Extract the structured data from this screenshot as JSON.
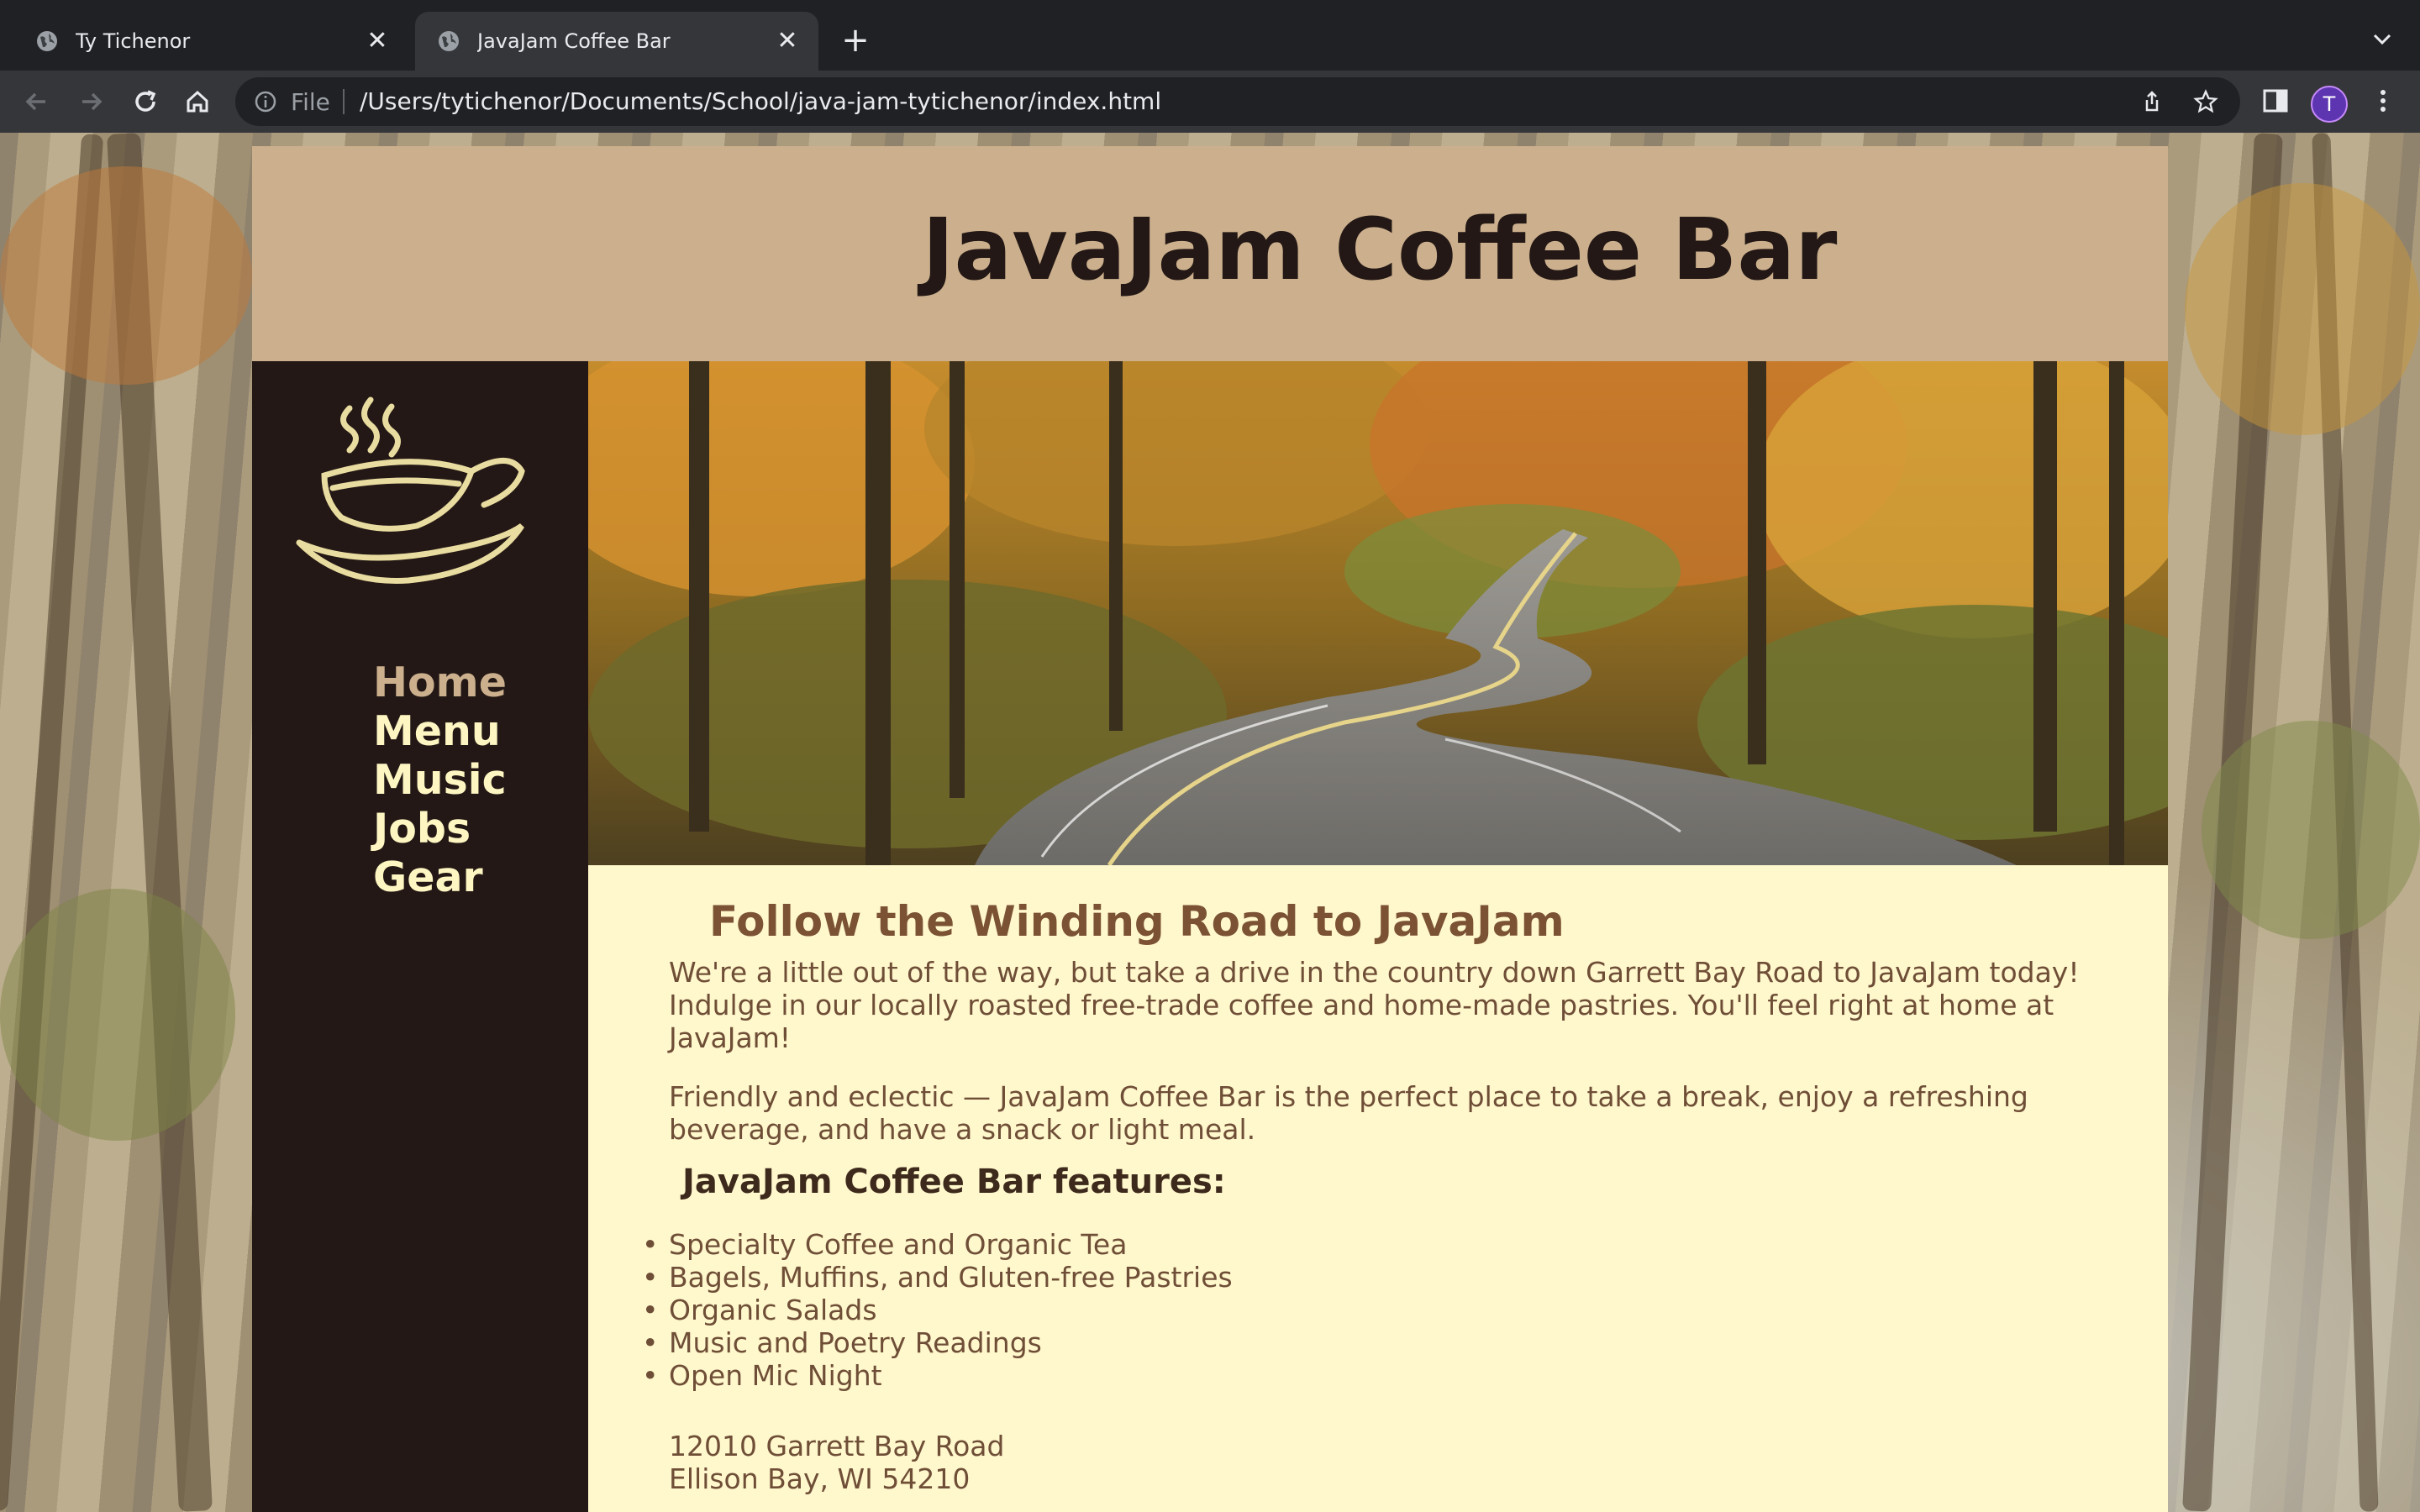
{
  "browser": {
    "tabs": [
      {
        "title": "Ty Tichenor",
        "active": false
      },
      {
        "title": "JavaJam Coffee Bar",
        "active": true
      }
    ],
    "address_bar": {
      "scheme_label": "File",
      "url": "/Users/tytichenor/Documents/School/java-jam-tytichenor/index.html"
    },
    "profile_initial": "T",
    "accent_color": "#5e35b1"
  },
  "page": {
    "site_title": "JavaJam Coffee Bar",
    "nav": [
      {
        "label": "Home",
        "current": true
      },
      {
        "label": "Menu",
        "current": false
      },
      {
        "label": "Music",
        "current": false
      },
      {
        "label": "Jobs",
        "current": false
      },
      {
        "label": "Gear",
        "current": false
      }
    ],
    "heading": "Follow the Winding Road to JavaJam",
    "intro_paragraph": "We're a little out of the way, but take a drive in the country down Garrett Bay Road to JavaJam today! Indulge in our locally roasted free-trade coffee and home-made pastries. You'll feel right at home at JavaJam!",
    "second_paragraph": "Friendly and eclectic — JavaJam Coffee Bar is the perfect place to take a break, enjoy a refreshing beverage, and have a snack or light meal.",
    "features_heading": "JavaJam Coffee Bar features:",
    "features": [
      "Specialty Coffee and Organic Tea",
      "Bagels, Muffins, and Gluten-free Pastries",
      "Organic Salads",
      "Music and Poetry Readings",
      "Open Mic Night"
    ],
    "address_line1": "12010 Garrett Bay Road",
    "address_line2": "Ellison Bay, WI 54210",
    "colors": {
      "header_bg": "#ccb08e",
      "sidebar_bg": "#231815",
      "content_bg": "#fff8cc",
      "nav_text": "#fef6c2",
      "nav_current": "#ccb08e",
      "heading_text": "#7b5234"
    }
  }
}
